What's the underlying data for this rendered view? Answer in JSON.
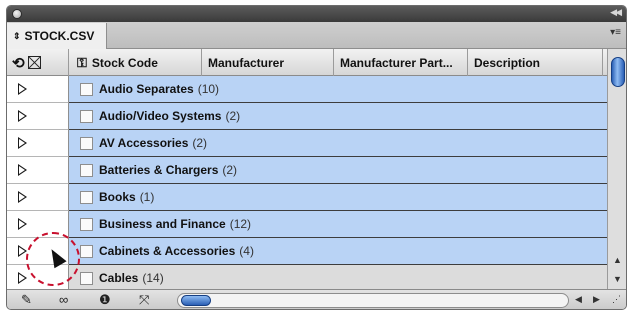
{
  "panel": {
    "tab_title": "STOCK.CSV",
    "icons": {
      "close": "close-dot",
      "collapse": "double-chevron-icon",
      "menu": "panel-menu-icon"
    }
  },
  "columns": {
    "code": "Stock Code",
    "manufacturer": "Manufacturer",
    "part": "Manufacturer Part...",
    "description": "Description"
  },
  "rows": [
    {
      "name": "Audio Separates",
      "count": "(10)"
    },
    {
      "name": "Audio/Video Systems",
      "count": "(2)"
    },
    {
      "name": "AV Accessories",
      "count": "(2)"
    },
    {
      "name": "Batteries & Chargers",
      "count": "(2)"
    },
    {
      "name": "Books",
      "count": "(1)"
    },
    {
      "name": "Business and Finance",
      "count": "(12)"
    },
    {
      "name": "Cabinets & Accessories",
      "count": "(4)"
    },
    {
      "name": "Cables",
      "count": "(14)"
    }
  ],
  "footer_icons": [
    "pen-icon",
    "binoculars-icon",
    "info-icon",
    "cross-arrows-icon"
  ],
  "colors": {
    "row_selected": "#b9d3f5",
    "scroll_thumb": "#2a5fb5",
    "cursor_ring": "#c8102e"
  }
}
